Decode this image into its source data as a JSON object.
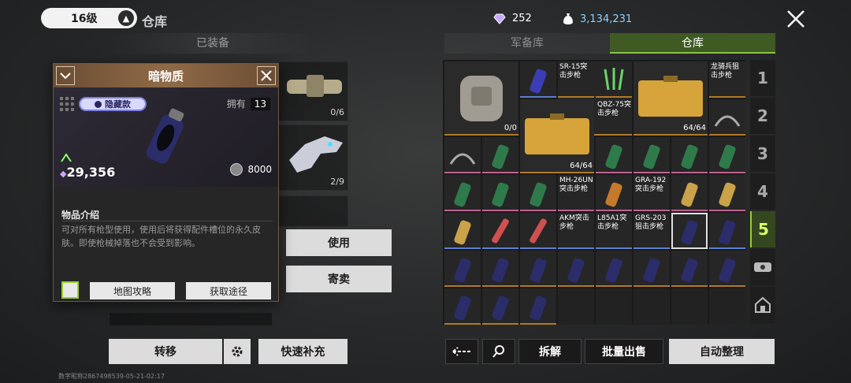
{
  "header": {
    "level": "16级",
    "title": "仓库",
    "gems": "252",
    "money": "3,134,231"
  },
  "left": {
    "equipped_label": "已装备",
    "slot_counts": [
      "0/6",
      "2/9"
    ],
    "buttons": {
      "use": "使用",
      "consign": "寄卖",
      "transfer": "转移",
      "quick_refill": "快速补充"
    },
    "footnote": "数字昵称2867498539-05-21-02:17"
  },
  "popup": {
    "title": "暗物质",
    "rarity": "隐藏款",
    "owned_label": "拥有",
    "owned_count": "13",
    "value": "29,356",
    "sell_value": "8000",
    "desc_title": "物品介绍",
    "desc": "可对所有枪型使用，使用后将获得配件槽位的永久皮肤。即使枪械掉落也不会受到影响。",
    "btn_map": "地图攻略",
    "btn_source": "获取途径"
  },
  "tabs": {
    "armory": "军备库",
    "warehouse": "仓库"
  },
  "side_tabs": [
    "1",
    "2",
    "3",
    "4",
    "5"
  ],
  "grid_labels": {
    "sr15": "SR-15突击步枪",
    "qbz": "QBZ-75突击步枪",
    "dragoon": "龙骑兵狙击步枪",
    "mh": "MH-26UN突击步枪",
    "gra192": "GRA-192突击步枪",
    "akm": "AKM突击步枪",
    "l85": "L85A1突击步枪",
    "grs": "GRS-203狙击步枪"
  },
  "grid_counts": {
    "backpack": "0/0",
    "case1": "64/64",
    "case2": "64/64"
  },
  "bottom_right": {
    "dismantle": "拆解",
    "bulk_sell": "批量出售",
    "auto_sort": "自动整理"
  },
  "colors": {
    "accent_green": "#8bc34a",
    "gold": "#b07a2a",
    "pink": "#c06090"
  }
}
